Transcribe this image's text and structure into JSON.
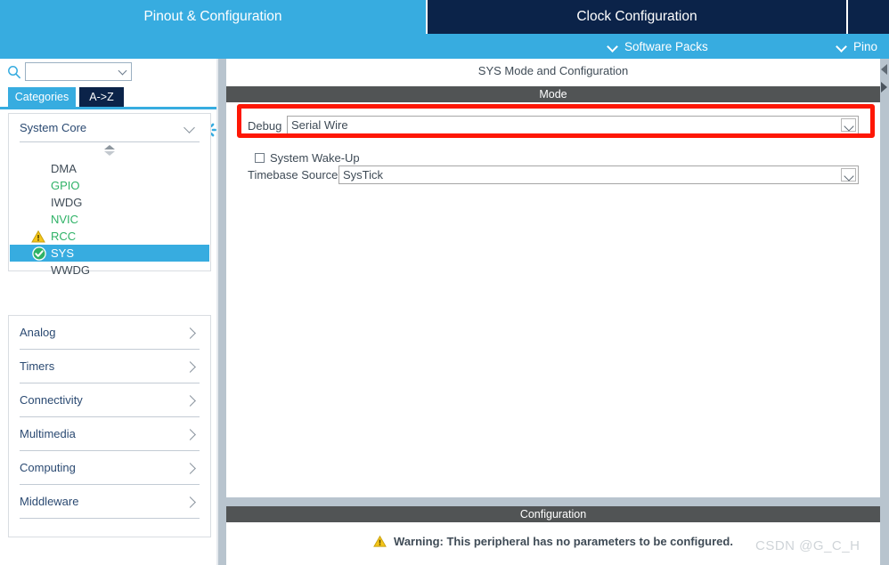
{
  "tabs": [
    {
      "label": "Pinout & Configuration",
      "state": "active"
    },
    {
      "label": "Clock Configuration",
      "state": "inactive"
    }
  ],
  "subbar": [
    {
      "label": "Software Packs",
      "icon": "chevron-down-icon"
    },
    {
      "label": "Pino",
      "icon": "chevron-down-icon"
    }
  ],
  "sidebar": {
    "search": {
      "value": "",
      "placeholder": "",
      "icon": "search-icon",
      "dropdown_icon": "chevron-down-icon"
    },
    "settings_icon": "gear-icon",
    "mode_tabs": [
      {
        "label": "Categories",
        "selected": true
      },
      {
        "label": "A->Z",
        "selected": false
      }
    ],
    "groups": [
      {
        "label": "System Core",
        "expanded": true,
        "chevron": "chevron-down-icon"
      },
      {
        "label": "Analog",
        "expanded": false,
        "chevron": "chevron-right-icon"
      },
      {
        "label": "Timers",
        "expanded": false,
        "chevron": "chevron-right-icon"
      },
      {
        "label": "Connectivity",
        "expanded": false,
        "chevron": "chevron-right-icon"
      },
      {
        "label": "Multimedia",
        "expanded": false,
        "chevron": "chevron-right-icon"
      },
      {
        "label": "Computing",
        "expanded": false,
        "chevron": "chevron-right-icon"
      },
      {
        "label": "Middleware",
        "expanded": false,
        "chevron": "chevron-right-icon"
      }
    ],
    "peripherals": [
      {
        "name": "DMA",
        "status": "none",
        "icon": "",
        "selected": false
      },
      {
        "name": "GPIO",
        "status": "ok",
        "icon": "",
        "selected": false
      },
      {
        "name": "IWDG",
        "status": "none",
        "icon": "",
        "selected": false
      },
      {
        "name": "NVIC",
        "status": "ok",
        "icon": "",
        "selected": false
      },
      {
        "name": "RCC",
        "status": "warning",
        "icon": "warning-triangle-icon",
        "selected": false
      },
      {
        "name": "SYS",
        "status": "selected",
        "icon": "check-circle-icon",
        "selected": true
      },
      {
        "name": "WWDG",
        "status": "none",
        "icon": "",
        "selected": false
      }
    ],
    "scroll_spinner_icon": "up-down-spinner-icon"
  },
  "content": {
    "panel_title": "SYS Mode and Configuration",
    "mode_section": {
      "header": "Mode",
      "debug": {
        "label": "Debug",
        "value": "Serial Wire",
        "dropdown_icon": "chevron-down-icon",
        "highlighted": true,
        "highlight_color": "#fe1705"
      },
      "system_wakeup": {
        "label": "System Wake-Up",
        "checked": false
      },
      "timebase": {
        "label": "Timebase Source",
        "value": "SysTick",
        "dropdown_icon": "chevron-down-icon"
      }
    },
    "config_section": {
      "header": "Configuration",
      "warning_icon": "warning-triangle-icon",
      "warning_text": "Warning: This peripheral has no parameters to be configured."
    }
  },
  "watermark": "CSDN @G_C_H",
  "colors": {
    "accent_blue": "#37ace0",
    "dark_navy": "#0b2349",
    "section_gray": "#515455",
    "highlight_red": "#fe1705",
    "status_green": "#2eb266",
    "warning_yellow": "#f5c518"
  }
}
